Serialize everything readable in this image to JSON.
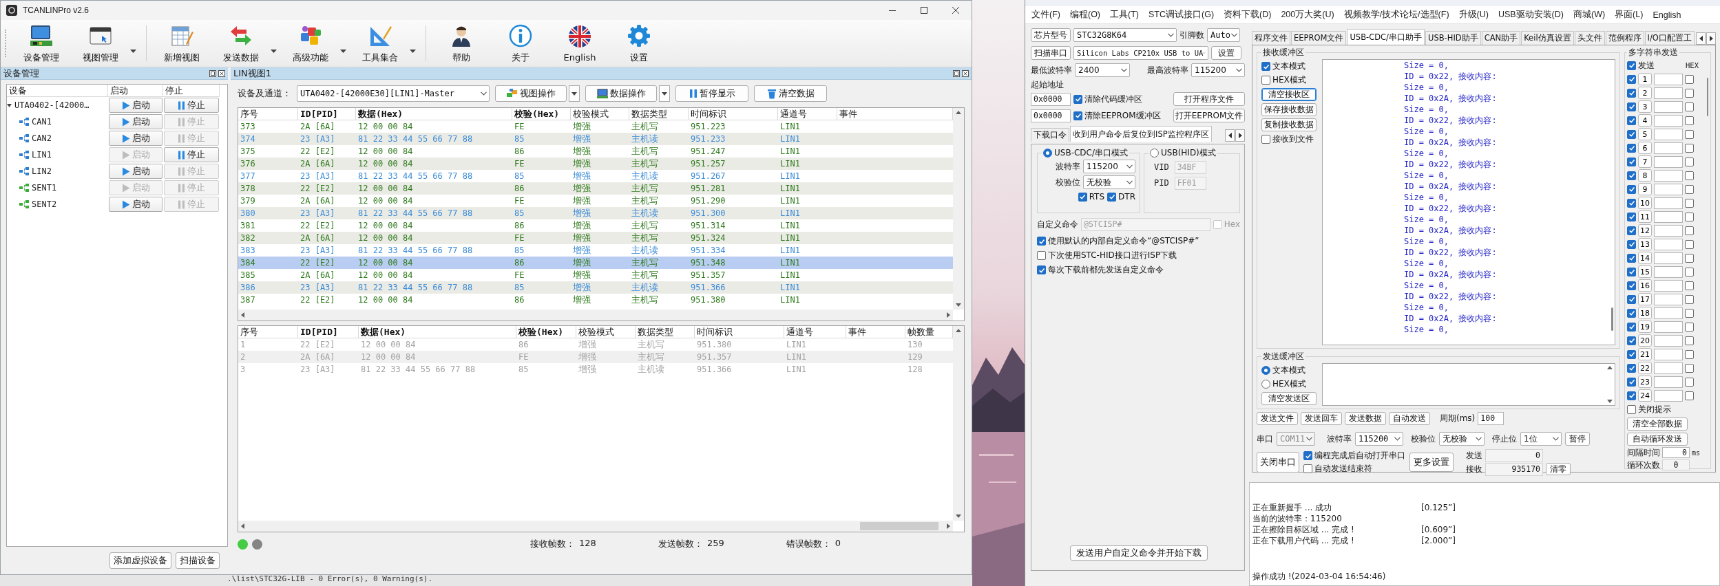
{
  "tcanlin": {
    "title": "TCANLINPro v2.6",
    "toolbar": [
      {
        "items": [
          {
            "label": "设备管理",
            "kind": "monitor",
            "dropdown": false
          },
          {
            "label": "视图管理",
            "kind": "window",
            "dropdown": true
          }
        ]
      },
      {
        "items": [
          {
            "label": "新增视图",
            "kind": "sheet",
            "dropdown": false
          },
          {
            "label": "发送数据",
            "kind": "arrows",
            "dropdown": true
          },
          {
            "label": "高级功能",
            "kind": "puzzle",
            "dropdown": true
          },
          {
            "label": "工具集合",
            "kind": "ruler",
            "dropdown": true
          }
        ]
      },
      {
        "items": [
          {
            "label": "帮助",
            "kind": "person",
            "dropdown": false
          },
          {
            "label": "关于",
            "kind": "info",
            "dropdown": false
          },
          {
            "label": "English",
            "kind": "flag",
            "dropdown": false
          },
          {
            "label": "设置",
            "kind": "gear",
            "dropdown": false
          }
        ]
      }
    ],
    "device_panel": {
      "title": "设备管理",
      "columns": [
        "设备",
        "启动",
        "停止"
      ],
      "devices": [
        {
          "name": "UTA0402-[42000…",
          "expanded": true,
          "start": {
            "label": "启动",
            "enabled": true
          },
          "stop": {
            "label": "停止",
            "enabled": true
          },
          "children": [
            {
              "name": "CAN1",
              "color": "#2f7fd0",
              "start": {
                "label": "启动",
                "enabled": true
              },
              "stop": {
                "label": "停止",
                "enabled": false
              }
            },
            {
              "name": "CAN2",
              "color": "#2f7fd0",
              "start": {
                "label": "启动",
                "enabled": true
              },
              "stop": {
                "label": "停止",
                "enabled": false
              }
            },
            {
              "name": "LIN1",
              "color": "#2f7fd0",
              "start": {
                "label": "启动",
                "enabled": false
              },
              "stop": {
                "label": "停止",
                "enabled": true
              }
            },
            {
              "name": "LIN2",
              "color": "#2f7fd0",
              "start": {
                "label": "启动",
                "enabled": true
              },
              "stop": {
                "label": "停止",
                "enabled": false
              }
            },
            {
              "name": "SENT1",
              "color": "#3aae3a",
              "start": {
                "label": "启动",
                "enabled": false
              },
              "stop": {
                "label": "停止",
                "enabled": false
              }
            },
            {
              "name": "SENT2",
              "color": "#3aae3a",
              "start": {
                "label": "启动",
                "enabled": true
              },
              "stop": {
                "label": "停止",
                "enabled": false
              }
            }
          ]
        }
      ],
      "buttons": [
        "添加虚拟设备",
        "扫描设备"
      ]
    },
    "view_panel": {
      "title": "LIN视图1",
      "channel_label": "设备及通道：",
      "channel_value": "UTA0402-[42000E30][LIN1]-Master",
      "actions": [
        {
          "label": "视图操作",
          "kind": "view",
          "dropdown": true
        },
        {
          "label": "数据操作",
          "kind": "data",
          "dropdown": true
        },
        {
          "label": "暂停显示",
          "kind": "pause",
          "dropdown": false
        },
        {
          "label": "清空数据",
          "kind": "clear",
          "dropdown": false
        }
      ],
      "frames": {
        "columns": [
          "序号",
          "ID[PID]",
          "数据(Hex)",
          "校验(Hex)",
          "校验模式",
          "数据类型",
          "时间标识",
          "通道号",
          "事件"
        ],
        "rows": [
          {
            "no": "373",
            "id": "2A [6A]",
            "data": "12 00 00 84",
            "checksum": "FE",
            "mode": "增强",
            "type": "主机写",
            "time": "951.223",
            "channel": "LIN1",
            "kind": "write",
            "selected": false
          },
          {
            "no": "374",
            "id": "23 [A3]",
            "data": "81 22 33 44 55 66 77 88",
            "checksum": "85",
            "mode": "增强",
            "type": "主机读",
            "time": "951.233",
            "channel": "LIN1",
            "kind": "read",
            "selected": false
          },
          {
            "no": "375",
            "id": "22 [E2]",
            "data": "12 00 00 84",
            "checksum": "86",
            "mode": "增强",
            "type": "主机写",
            "time": "951.247",
            "channel": "LIN1",
            "kind": "write",
            "selected": false
          },
          {
            "no": "376",
            "id": "2A [6A]",
            "data": "12 00 00 84",
            "checksum": "FE",
            "mode": "增强",
            "type": "主机写",
            "time": "951.257",
            "channel": "LIN1",
            "kind": "write",
            "selected": false
          },
          {
            "no": "377",
            "id": "23 [A3]",
            "data": "81 22 33 44 55 66 77 88",
            "checksum": "85",
            "mode": "增强",
            "type": "主机读",
            "time": "951.267",
            "channel": "LIN1",
            "kind": "read",
            "selected": false
          },
          {
            "no": "378",
            "id": "22 [E2]",
            "data": "12 00 00 84",
            "checksum": "86",
            "mode": "增强",
            "type": "主机写",
            "time": "951.281",
            "channel": "LIN1",
            "kind": "write",
            "selected": false
          },
          {
            "no": "379",
            "id": "2A [6A]",
            "data": "12 00 00 84",
            "checksum": "FE",
            "mode": "增强",
            "type": "主机写",
            "time": "951.290",
            "channel": "LIN1",
            "kind": "write",
            "selected": false
          },
          {
            "no": "380",
            "id": "23 [A3]",
            "data": "81 22 33 44 55 66 77 88",
            "checksum": "85",
            "mode": "增强",
            "type": "主机读",
            "time": "951.300",
            "channel": "LIN1",
            "kind": "read",
            "selected": false
          },
          {
            "no": "381",
            "id": "22 [E2]",
            "data": "12 00 00 84",
            "checksum": "86",
            "mode": "增强",
            "type": "主机写",
            "time": "951.314",
            "channel": "LIN1",
            "kind": "write",
            "selected": false
          },
          {
            "no": "382",
            "id": "2A [6A]",
            "data": "12 00 00 84",
            "checksum": "FE",
            "mode": "增强",
            "type": "主机写",
            "time": "951.324",
            "channel": "LIN1",
            "kind": "write",
            "selected": false
          },
          {
            "no": "383",
            "id": "23 [A3]",
            "data": "81 22 33 44 55 66 77 88",
            "checksum": "85",
            "mode": "增强",
            "type": "主机读",
            "time": "951.334",
            "channel": "LIN1",
            "kind": "read",
            "selected": false
          },
          {
            "no": "384",
            "id": "22 [E2]",
            "data": "12 00 00 84",
            "checksum": "86",
            "mode": "增强",
            "type": "主机写",
            "time": "951.348",
            "channel": "LIN1",
            "kind": "write",
            "selected": true
          },
          {
            "no": "385",
            "id": "2A [6A]",
            "data": "12 00 00 84",
            "checksum": "FE",
            "mode": "增强",
            "type": "主机写",
            "time": "951.357",
            "channel": "LIN1",
            "kind": "write",
            "selected": false
          },
          {
            "no": "386",
            "id": "23 [A3]",
            "data": "81 22 33 44 55 66 77 88",
            "checksum": "85",
            "mode": "增强",
            "type": "主机读",
            "time": "951.366",
            "channel": "LIN1",
            "kind": "read",
            "selected": false
          },
          {
            "no": "387",
            "id": "22 [E2]",
            "data": "12 00 00 84",
            "checksum": "86",
            "mode": "增强",
            "type": "主机写",
            "time": "951.380",
            "channel": "LIN1",
            "kind": "write",
            "selected": false
          }
        ]
      },
      "summary": {
        "columns": [
          "序号",
          "ID[PID]",
          "数据(Hex)",
          "校验(Hex)",
          "校验模式",
          "数据类型",
          "时间标识",
          "通道号",
          "事件",
          "帧数量"
        ],
        "rows": [
          {
            "no": "1",
            "id": "22 [E2]",
            "data": "12 00 00 84",
            "checksum": "86",
            "mode": "增强",
            "type": "主机写",
            "time": "951.380",
            "channel": "LIN1",
            "count": "130"
          },
          {
            "no": "2",
            "id": "2A [6A]",
            "data": "12 00 00 84",
            "checksum": "FE",
            "mode": "增强",
            "type": "主机写",
            "time": "951.357",
            "channel": "LIN1",
            "count": "129"
          },
          {
            "no": "3",
            "id": "23 [A3]",
            "data": "81 22 33 44 55 66 77 88",
            "checksum": "85",
            "mode": "增强",
            "type": "主机读",
            "time": "951.366",
            "channel": "LIN1",
            "count": "128"
          }
        ]
      },
      "status": {
        "lights": [
          {
            "color": "#44cc44"
          },
          {
            "color": "#858585"
          }
        ],
        "counters": [
          {
            "label": "接收帧数：",
            "value": "128"
          },
          {
            "label": "发送帧数：",
            "value": "259"
          },
          {
            "label": "错误帧数：",
            "value": "0"
          }
        ]
      }
    }
  },
  "background_editor": {
    "text": ".\\list\\STC32G-LIB - 0 Error(s), 0 Warning(s)."
  },
  "stc_isp": {
    "menu": [
      "文件(F)",
      "编程(O)",
      "工具(T)",
      "STC调试接口(G)",
      "资料下载(D)",
      "200万大奖(U)",
      "视频教学/技术论坛/选型(F)",
      "升级(U)",
      "USB驱动安装(D)",
      "商城(W)",
      "界面(L)",
      "English"
    ],
    "chip": {
      "button": "芯片型号",
      "value": "STC32G8K64",
      "pins_label": "引脚数",
      "pins_value": "Auto"
    },
    "port": {
      "button": "扫描串口",
      "value": "Silicon Labs CP210x USB to UA",
      "settings_button": "设置"
    },
    "baud": {
      "min_label": "最低波特率",
      "min_value": "2400",
      "max_label": "最高波特率",
      "max_value": "115200"
    },
    "start_address_label": "起始地址",
    "address_rows": [
      {
        "value": "0x0000",
        "label": "清除代码缓冲区",
        "checked": true,
        "button": "打开程序文件"
      },
      {
        "value": "0x0000",
        "label": "清除EEPROM缓冲区",
        "checked": true,
        "button": "打开EEPROM文件"
      }
    ],
    "option_tabs": [
      {
        "label": "下载口令",
        "selected": false
      },
      {
        "label": "收到用户命令后复位到ISP监控程序区",
        "selected": true
      }
    ],
    "cdc_mode": {
      "label": "USB-CDC/串口模式",
      "selected": true,
      "baud_label": "波特率",
      "baud_value": "115200",
      "parity_label": "校验位",
      "parity_value": "无校验",
      "flags": [
        {
          "label": "RTS",
          "checked": true
        },
        {
          "label": "DTR",
          "checked": true
        }
      ]
    },
    "hid_mode": {
      "label": "USB(HID)模式",
      "selected": false,
      "fields": [
        {
          "label": "VID",
          "value": "34BF"
        },
        {
          "label": "PID",
          "value": "FF01"
        }
      ]
    },
    "custom_command": {
      "label": "自定义命令",
      "value": "@STCISP#",
      "hex_label": "Hex",
      "hex_checked": false
    },
    "options": [
      {
        "label": "使用默认的内部自定义命令“@STCISP#”",
        "checked": true
      },
      {
        "label": "下次使用STC-HID接口进行ISP下载",
        "checked": false
      },
      {
        "label": "每次下载前都先发送自定义命令",
        "checked": true
      }
    ],
    "send_command_button": "发送用户自定义命令并开始下载",
    "tool_tabs": [
      {
        "label": "程序文件",
        "selected": false
      },
      {
        "label": "EEPROM文件",
        "selected": false
      },
      {
        "label": "USB-CDC/串口助手",
        "selected": true
      },
      {
        "label": "USB-HID助手",
        "selected": false
      },
      {
        "label": "CAN助手",
        "selected": false
      },
      {
        "label": "Keil仿真设置",
        "selected": false
      },
      {
        "label": "头文件",
        "selected": false
      },
      {
        "label": "范例程序",
        "selected": false
      },
      {
        "label": "I/O口配置工",
        "selected": false
      }
    ],
    "receive": {
      "title": "接收缓冲区",
      "modes": [
        {
          "label": "文本模式",
          "checked": true
        },
        {
          "label": "HEX模式",
          "checked": false
        }
      ],
      "buttons": [
        "清空接收区",
        "保存接收数据",
        "复制接收数据"
      ],
      "to_file": {
        "label": "接收到文件",
        "checked": false
      },
      "lines": [
        "Size = 0,",
        "ID = 0x22, 接收内容:",
        "Size = 0,",
        "ID = 0x2A, 接收内容:",
        "Size = 0,",
        "ID = 0x22, 接收内容:",
        "Size = 0,",
        "ID = 0x2A, 接收内容:",
        "Size = 0,",
        "ID = 0x22, 接收内容:",
        "Size = 0,",
        "ID = 0x2A, 接收内容:",
        "Size = 0,",
        "ID = 0x22, 接收内容:",
        "Size = 0,",
        "ID = 0x2A, 接收内容:",
        "Size = 0,",
        "ID = 0x22, 接收内容:",
        "Size = 0,",
        "ID = 0x2A, 接收内容:",
        "Size = 0,",
        "ID = 0x22, 接收内容:",
        "Size = 0,",
        "ID = 0x2A, 接收内容:",
        "Size = 0,"
      ]
    },
    "send": {
      "title": "发送缓冲区",
      "modes": [
        {
          "label": "文本模式",
          "selected": true
        },
        {
          "label": "HEX模式",
          "selected": false
        }
      ],
      "clear_button": "清空发送区",
      "actions": [
        "发送文件",
        "发送回车",
        "发送数据",
        "自动发送"
      ],
      "period_label": "周期(ms)",
      "period_value": "100"
    },
    "serial": {
      "port_label": "串口",
      "port_value": "COM11",
      "baud_label": "波特率",
      "baud_value": "115200",
      "parity_label": "校验位",
      "parity_value": "无校验",
      "stop_label": "停止位",
      "stop_value": "1位",
      "pause_button": "暂停",
      "close_button": "关闭串口",
      "options": [
        {
          "label": "编程完成后自动打开串口",
          "checked": true
        },
        {
          "label": "自动发送结束符",
          "checked": false
        }
      ],
      "more_button": "更多设置",
      "sent_label": "发送",
      "sent_value": "0",
      "received_label": "接收",
      "received_value": "935170",
      "clear_button": "清零"
    },
    "multi_send": {
      "title": "多字符串发送",
      "send_label": "发送",
      "send_checked": true,
      "hex_label": "HEX",
      "rows": [
        {
          "label": "1",
          "checked": true,
          "hex": false
        },
        {
          "label": "2",
          "checked": true,
          "hex": false
        },
        {
          "label": "3",
          "checked": true,
          "hex": false
        },
        {
          "label": "4",
          "checked": true,
          "hex": false
        },
        {
          "label": "5",
          "checked": true,
          "hex": false
        },
        {
          "label": "6",
          "checked": true,
          "hex": false
        },
        {
          "label": "7",
          "checked": true,
          "hex": false
        },
        {
          "label": "8",
          "checked": true,
          "hex": false
        },
        {
          "label": "9",
          "checked": true,
          "hex": false
        },
        {
          "label": "10",
          "checked": true,
          "hex": false
        },
        {
          "label": "11",
          "checked": true,
          "hex": false
        },
        {
          "label": "12",
          "checked": true,
          "hex": false
        },
        {
          "label": "13",
          "checked": true,
          "hex": false
        },
        {
          "label": "14",
          "checked": true,
          "hex": false
        },
        {
          "label": "15",
          "checked": true,
          "hex": false
        },
        {
          "label": "16",
          "checked": true,
          "hex": false
        },
        {
          "label": "17",
          "checked": true,
          "hex": false
        },
        {
          "label": "18",
          "checked": true,
          "hex": false
        },
        {
          "label": "19",
          "checked": true,
          "hex": false
        },
        {
          "label": "20",
          "checked": true,
          "hex": false
        },
        {
          "label": "21",
          "checked": true,
          "hex": false
        },
        {
          "label": "22",
          "checked": true,
          "hex": false
        },
        {
          "label": "23",
          "checked": true,
          "hex": false
        },
        {
          "label": "24",
          "checked": true,
          "hex": false
        }
      ],
      "close_hint": {
        "label": "关闭提示",
        "checked": false
      },
      "buttons": [
        "清空全部数据",
        "自动循环发送"
      ],
      "interval_label": "间隔时间",
      "interval_value": "0",
      "interval_unit": "ms",
      "loop_label": "循环次数",
      "loop_value": "0"
    },
    "log": [
      {
        "text": "正在重新握手 ... 成功",
        "time": "[0.125”]",
        "kind": "step"
      },
      {
        "text": "当前的波特率：115200",
        "kind": "step"
      },
      {
        "text": "正在擦除目标区域 ... 完成 !",
        "time": "[0.609”]",
        "kind": "step"
      },
      {
        "text": "正在下载用户代码 ... 完成 !",
        "time": "[2.000”]",
        "kind": "step"
      },
      {
        "text": "操作成功 !(2024-03-04 16:54:46)",
        "kind": "result"
      }
    ]
  }
}
